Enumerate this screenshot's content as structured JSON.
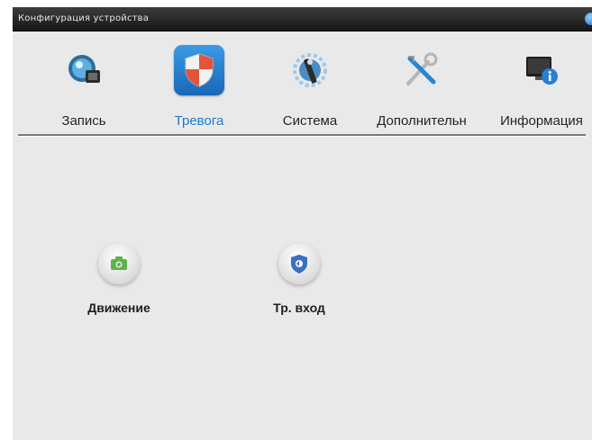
{
  "window": {
    "title": "Конфигурация устройства"
  },
  "tabs": [
    {
      "label": "Запись",
      "icon": "record-icon"
    },
    {
      "label": "Тревога",
      "icon": "alarm-shield-icon",
      "active": true
    },
    {
      "label": "Система",
      "icon": "system-icon"
    },
    {
      "label": "Дополнительн",
      "icon": "tools-icon"
    },
    {
      "label": "Информация",
      "icon": "info-monitor-icon"
    }
  ],
  "items": [
    {
      "label": "Движение",
      "icon": "motion-camera-icon"
    },
    {
      "label": "Тр. вход",
      "icon": "alarm-input-icon"
    }
  ],
  "colors": {
    "active_tab": "#1874c9",
    "accent": "#1f6fc4"
  }
}
